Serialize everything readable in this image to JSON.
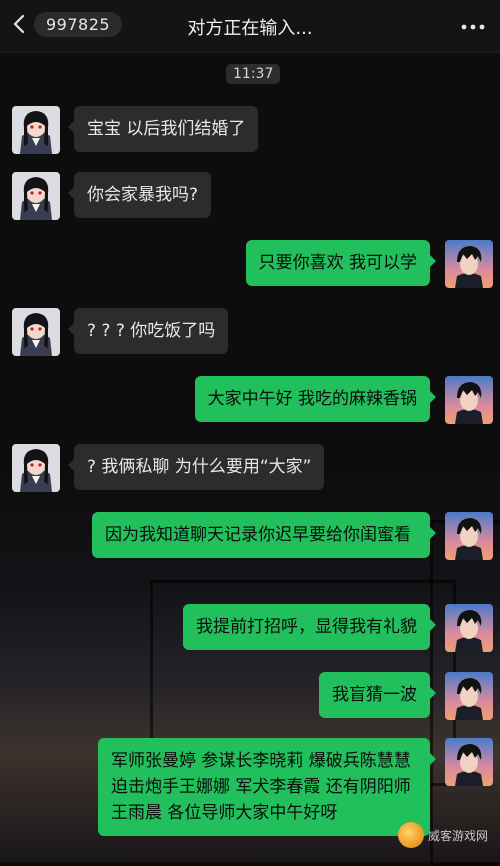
{
  "header": {
    "back_count": "997825",
    "title": "对方正在输入..."
  },
  "time_label": "11:37",
  "messages": [
    {
      "side": "left",
      "text": "宝宝 以后我们结婚了"
    },
    {
      "side": "left",
      "text": "你会家暴我吗?"
    },
    {
      "side": "right",
      "text": "只要你喜欢 我可以学"
    },
    {
      "side": "left",
      "text": "? ? ? 你吃饭了吗"
    },
    {
      "side": "right",
      "text": "大家中午好 我吃的麻辣香锅"
    },
    {
      "side": "left",
      "text": "? 我俩私聊 为什么要用“大家”"
    },
    {
      "side": "right",
      "text": "因为我知道聊天记录你迟早要给你闺蜜看"
    },
    {
      "side": "right",
      "text": "我提前打招呼，显得我有礼貌"
    },
    {
      "side": "right",
      "text": "我盲猜一波"
    },
    {
      "side": "right",
      "text": "军师张曼婷 参谋长李晓莉 爆破兵陈慧慧 迫击炮手王娜娜 军犬李春霞 还有阴阳师王雨晨 各位导师大家中午好呀"
    }
  ],
  "watermark": "威客游戏网",
  "colors": {
    "bubble_right": "#22c05c",
    "bubble_left": "#2c2c2e",
    "background": "#0d0d0e"
  },
  "icons": {
    "back": "chevron-left-icon",
    "more": "more-dots-icon"
  }
}
